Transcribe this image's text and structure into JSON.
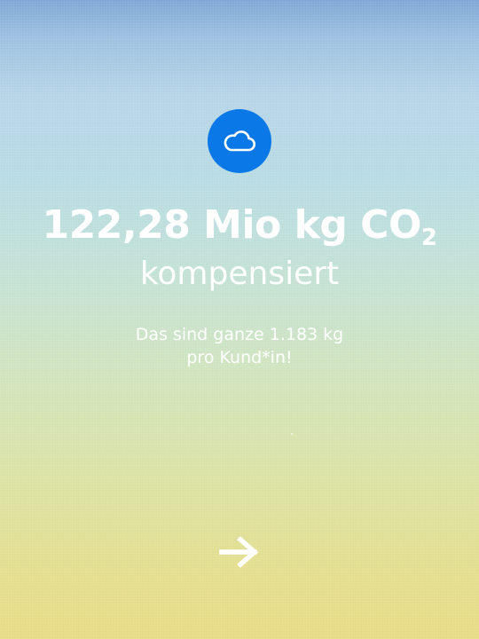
{
  "hero": {
    "icon": "cloud-icon",
    "icon_color": "#0a78e6",
    "headline_main": "122,28 Mio kg CO",
    "headline_subscript": "2",
    "subheadline": "kompensiert",
    "body_line_1": "Das sind ganze 1.183 kg",
    "body_line_2": "pro Kund*in!"
  },
  "navigation": {
    "next_icon": "arrow-right-icon"
  }
}
